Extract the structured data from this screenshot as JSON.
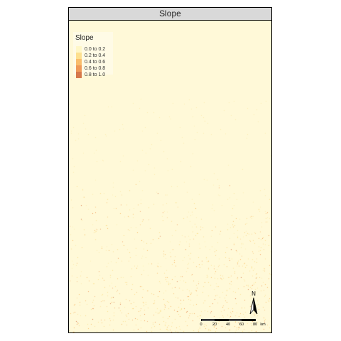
{
  "panel": {
    "title": "Slope"
  },
  "legend": {
    "title": "Slope",
    "items": [
      {
        "label": "0.0 to 0.2",
        "color": "#fff7c7"
      },
      {
        "label": "0.2 to 0.4",
        "color": "#fde08f"
      },
      {
        "label": "0.4 to 0.6",
        "color": "#f9bd6c"
      },
      {
        "label": "0.6 to 0.8",
        "color": "#ef9a59"
      },
      {
        "label": "0.8 to 1.0",
        "color": "#d6784b"
      }
    ]
  },
  "map": {
    "background_color": "#fff9d8",
    "class_colors": [
      "#fff7c7",
      "#fde08f",
      "#f9bd6c",
      "#ef9a59",
      "#d6784b"
    ]
  },
  "north_arrow": {
    "label": "N"
  },
  "scalebar": {
    "ticks": [
      "0",
      "20",
      "40",
      "60",
      "80"
    ],
    "unit": "km"
  }
}
